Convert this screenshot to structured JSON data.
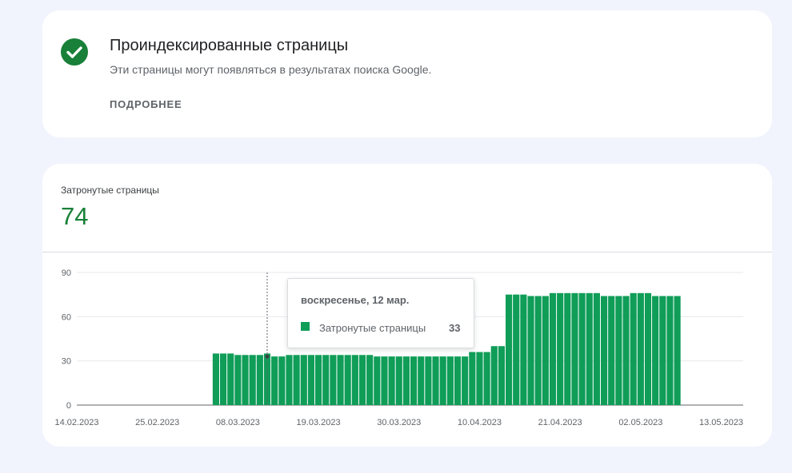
{
  "status_card": {
    "title": "Проиндексированные страницы",
    "description": "Эти страницы могут появляться в результатах поиска Google.",
    "details_link": "ПОДРОБНЕЕ",
    "icon": "check-circle-icon",
    "icon_color": "#188038"
  },
  "metric": {
    "label": "Затронутые страницы",
    "value": "74",
    "value_color": "#188038"
  },
  "tooltip": {
    "date": "воскресенье, 12 мар.",
    "series_name": "Затронутые страницы",
    "value": "33"
  },
  "chart_data": {
    "type": "bar",
    "series_name": "Затронутые страницы",
    "bar_color": "#0f9d58",
    "start_date": "05.03.2023",
    "end_date": "13.05.2023",
    "x_tick_labels": [
      "14.02.2023",
      "25.02.2023",
      "08.03.2023",
      "19.03.2023",
      "30.03.2023",
      "10.04.2023",
      "21.04.2023",
      "02.05.2023",
      "13.05.2023"
    ],
    "x_range": [
      "14.02.2023",
      "16.05.2023"
    ],
    "y_ticks": [
      0,
      30,
      60,
      90
    ],
    "ylim": [
      0,
      90
    ],
    "grid": true,
    "highlight_date": "12.03.2023",
    "values": [
      35,
      35,
      35,
      34,
      34,
      34,
      34,
      35,
      33,
      33,
      34,
      34,
      34,
      34,
      34,
      34,
      34,
      34,
      34,
      34,
      34,
      34,
      33,
      33,
      33,
      33,
      33,
      33,
      33,
      33,
      33,
      33,
      33,
      33,
      33,
      36,
      36,
      36,
      40,
      40,
      75,
      75,
      75,
      74,
      74,
      74,
      76,
      76,
      76,
      76,
      76,
      76,
      76,
      74,
      74,
      74,
      74,
      76,
      76,
      76,
      74,
      74,
      74,
      74
    ]
  }
}
